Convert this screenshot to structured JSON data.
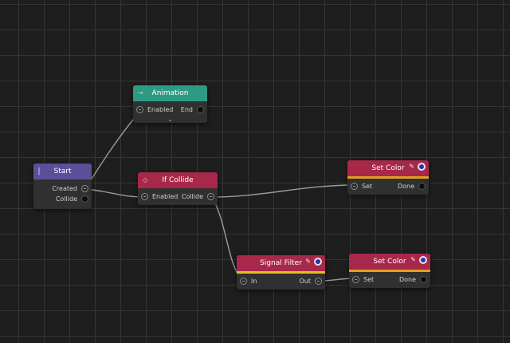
{
  "colors": {
    "canvas_background": "#1e1e1e",
    "grid_line": "#353535",
    "node_body": "#303030",
    "wire": "#9a9a9a",
    "start_header": "#5c4f9a",
    "animation_header": "#2f9a84",
    "logic_header": "#a8284a",
    "set_color_accent": "#e0a020",
    "signal_filter_accent": "#e0c020",
    "color_swatch": "#2f2fb0"
  },
  "nodes": {
    "start": {
      "title": "Start",
      "header_icon": "gear-icon",
      "outputs": [
        "Created",
        "Collide"
      ]
    },
    "animation": {
      "title": "Animation",
      "header_icon": "arrow-right-icon",
      "input": "Enabled",
      "output": "End",
      "expand_icon": "chevron-down-icon",
      "expand_glyph": "⌄"
    },
    "if_collide": {
      "title": "If Collide",
      "header_icon": "diamond-arrows-icon",
      "header_glyph": "◇",
      "input": "Enabled",
      "output": "Collide"
    },
    "set_color_1": {
      "title": "Set Color",
      "pin_icon": "pin-icon",
      "pin_glyph": "✎",
      "swatch_icon": "color-swatch-icon",
      "input": "Set",
      "output": "Done"
    },
    "signal_filter": {
      "title": "Signal Filter",
      "pin_icon": "pin-icon",
      "pin_glyph": "✎",
      "swatch_icon": "color-swatch-icon",
      "input": "In",
      "output": "Out"
    },
    "set_color_2": {
      "title": "Set Color",
      "pin_icon": "pin-icon",
      "pin_glyph": "✎",
      "swatch_icon": "color-swatch-icon",
      "input": "Set",
      "output": "Done"
    }
  },
  "connections": [
    {
      "from": "Start.Created",
      "to": "Animation.Enabled"
    },
    {
      "from": "Start.Created",
      "to": "If Collide.Enabled"
    },
    {
      "from": "If Collide.Collide",
      "to": "Set Color.Set"
    },
    {
      "from": "If Collide.Collide",
      "to": "Signal Filter.In"
    },
    {
      "from": "Signal Filter.Out",
      "to": "Set Color.Set"
    }
  ]
}
